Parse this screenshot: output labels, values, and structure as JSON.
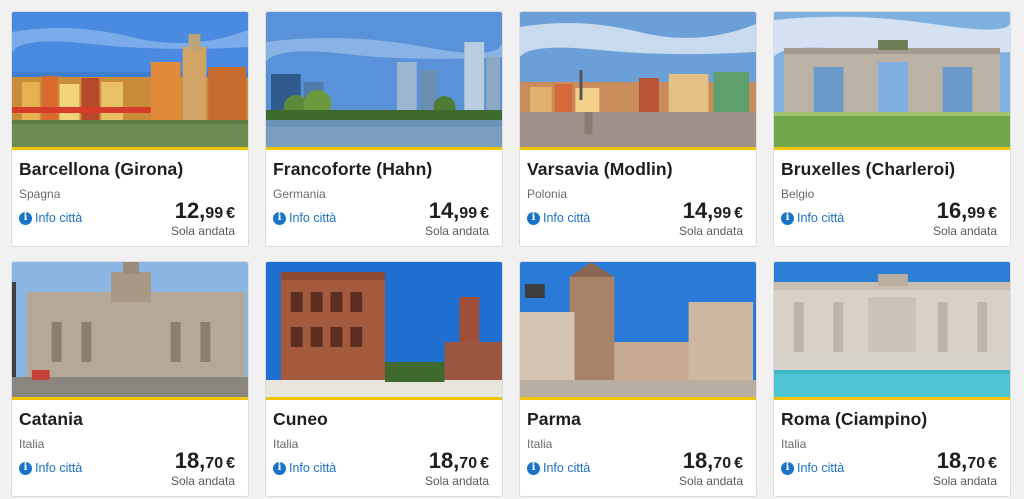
{
  "currency": "€",
  "oneway_label": "Sola andata",
  "info_label": "Info città",
  "cards": [
    {
      "city": "Barcellona (Girona)",
      "country": "Spagna",
      "price_int": "12,",
      "price_dec": "99",
      "image": "girona-riverside-houses"
    },
    {
      "city": "Francoforte (Hahn)",
      "country": "Germania",
      "price_int": "14,",
      "price_dec": "99",
      "image": "frankfurt-skyline"
    },
    {
      "city": "Varsavia (Modlin)",
      "country": "Polonia",
      "price_int": "14,",
      "price_dec": "99",
      "image": "warsaw-old-town"
    },
    {
      "city": "Bruxelles (Charleroi)",
      "country": "Belgio",
      "price_int": "16,",
      "price_dec": "99",
      "image": "brussels-cinquantenaire-arch"
    },
    {
      "city": "Catania",
      "country": "Italia",
      "price_int": "18,",
      "price_dec": "70",
      "image": "catania-cathedral"
    },
    {
      "city": "Cuneo",
      "country": "Italia",
      "price_int": "18,",
      "price_dec": "70",
      "image": "cuneo-brick-tower"
    },
    {
      "city": "Parma",
      "country": "Italia",
      "price_int": "18,",
      "price_dec": "70",
      "image": "parma-baptistery-tower"
    },
    {
      "city": "Roma (Ciampino)",
      "country": "Italia",
      "price_int": "18,",
      "price_dec": "70",
      "image": "rome-trevi-fountain"
    }
  ]
}
